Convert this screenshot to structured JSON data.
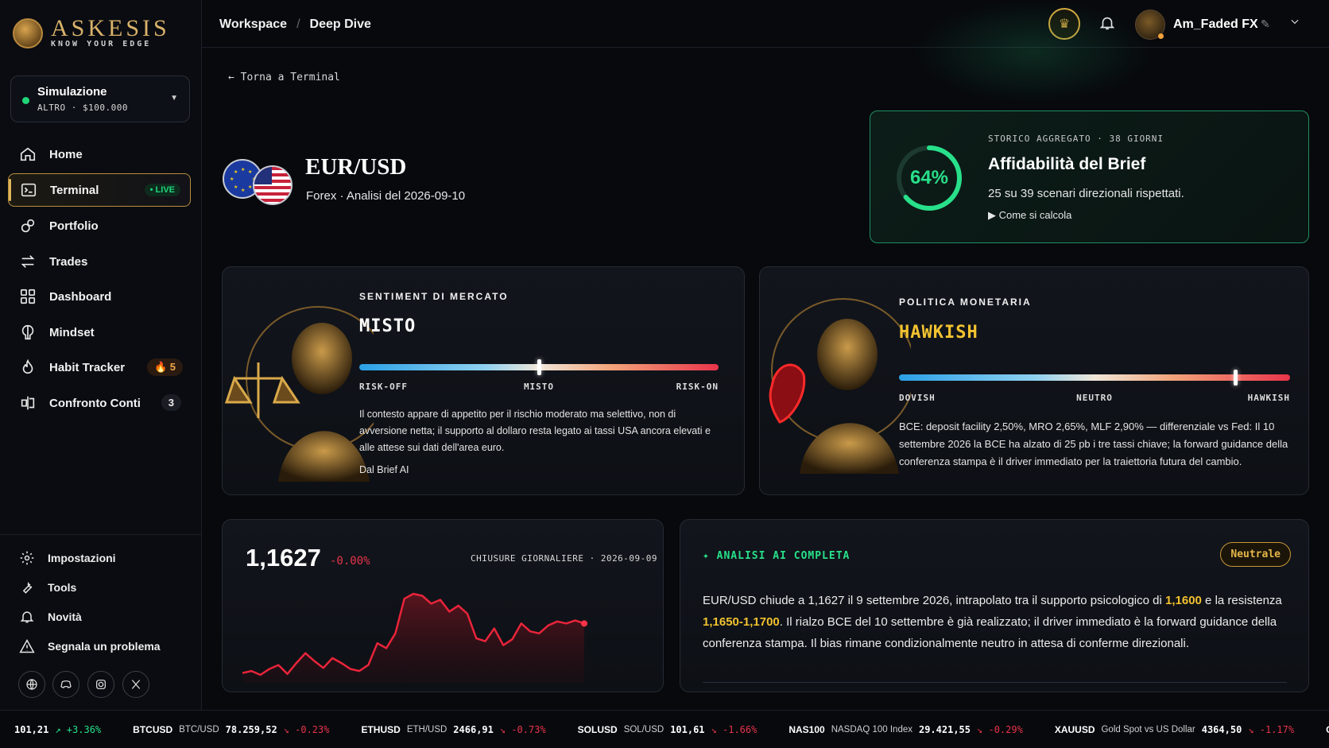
{
  "brand": {
    "name": "ASKESIS",
    "tagline": "KNOW YOUR EDGE"
  },
  "account": {
    "name": "Simulazione",
    "sub": "ALTRO · $100.000"
  },
  "sidebar": {
    "items": [
      {
        "label": "Home",
        "icon": "home-icon"
      },
      {
        "label": "Terminal",
        "icon": "terminal-icon",
        "badge": "• LIVE"
      },
      {
        "label": "Portfolio",
        "icon": "portfolio-icon"
      },
      {
        "label": "Trades",
        "icon": "trades-icon"
      },
      {
        "label": "Dashboard",
        "icon": "dashboard-icon"
      },
      {
        "label": "Mindset",
        "icon": "mindset-icon"
      },
      {
        "label": "Habit Tracker",
        "icon": "flame-icon",
        "badge": "5"
      },
      {
        "label": "Confronto Conti",
        "icon": "compare-icon",
        "badge": "3"
      }
    ],
    "bottom": [
      {
        "label": "Impostazioni",
        "icon": "gear-icon"
      },
      {
        "label": "Tools",
        "icon": "wrench-icon"
      },
      {
        "label": "Novità",
        "icon": "bell-icon"
      },
      {
        "label": "Segnala un problema",
        "icon": "warning-icon"
      }
    ],
    "social": [
      "globe-icon",
      "discord-icon",
      "instagram-icon",
      "x-icon"
    ]
  },
  "header": {
    "breadcrumb": [
      "Workspace",
      "Deep Dive"
    ],
    "username": "Am_Faded FX"
  },
  "page": {
    "back_label": "← Torna a Terminal",
    "pair": "EUR/USD",
    "subtitle": "Forex · Analisi del 2026-09-10"
  },
  "reliability": {
    "percent_label": "64%",
    "percent": 0.64,
    "kicker": "STORICO AGGREGATO · 38 GIORNI",
    "title": "Affidabilità del Brief",
    "desc": "25 su 39 scenari direzionali rispettati.",
    "how": "▶ Come si calcola"
  },
  "sentiment": {
    "kicker": "SENTIMENT DI MERCATO",
    "value": "MISTO",
    "position": 0.5,
    "labels": [
      "RISK-OFF",
      "MISTO",
      "RISK-ON"
    ],
    "text": "Il contesto appare di appetito per il rischio moderato ma selettivo, non di avversione netta; il supporto al dollaro resta legato ai tassi USA ancora elevati e alle attese sui dati dell'area euro.",
    "source": "Dal Brief AI"
  },
  "policy": {
    "kicker": "POLITICA MONETARIA",
    "value": "HAWKISH",
    "position": 0.86,
    "labels": [
      "DOVISH",
      "NEUTRO",
      "HAWKISH"
    ],
    "text": "BCE: deposit facility 2,50%, MRO 2,65%, MLF 2,90% — differenziale vs Fed: Il 10 settembre 2026 la BCE ha alzato di 25 pb i tre tassi chiave; la forward guidance della conferenza stampa è il driver immediato per la traiettoria futura del cambio."
  },
  "price": {
    "value": "1,1627",
    "change": "-0.00%",
    "meta": "CHIUSURE GIORNALIERE · 2026-09-09"
  },
  "chart_data": {
    "type": "area",
    "title": "",
    "xlabel": "",
    "ylabel": "",
    "values": [
      10,
      12,
      8,
      14,
      18,
      9,
      20,
      30,
      22,
      15,
      25,
      20,
      14,
      12,
      18,
      40,
      35,
      50,
      85,
      90,
      88,
      80,
      84,
      72,
      78,
      70,
      45,
      42,
      55,
      38,
      44,
      60,
      52,
      50,
      58,
      62,
      60,
      63,
      60
    ]
  },
  "analysis": {
    "kicker": "✦ ANALISI AI COMPLETA",
    "badge": "Neutrale",
    "p1": "EUR/USD chiude a 1,1627 il 9 settembre 2026, intrapolato tra il supporto psicologico di ",
    "h1": "1,1600",
    "p2": " e la resistenza ",
    "h2": "1,1650-1,1700",
    "p3": ". Il rialzo BCE del 10 settembre è già realizzato; il driver immediato è la forward guidance della conferenza stampa. Il bias rimane condizionalmente neutro in attesa di conferme direzionali."
  },
  "ticker": [
    {
      "sym": "",
      "name": "",
      "price": "101,21",
      "chg": "↗ +3.36%",
      "dir": "up"
    },
    {
      "sym": "BTCUSD",
      "name": "BTC/USD",
      "price": "78.259,52",
      "chg": "↘ -0.23%",
      "dir": "dn"
    },
    {
      "sym": "ETHUSD",
      "name": "ETH/USD",
      "price": "2466,91",
      "chg": "↘ -0.73%",
      "dir": "dn"
    },
    {
      "sym": "SOLUSD",
      "name": "SOL/USD",
      "price": "101,61",
      "chg": "↘ -1.66%",
      "dir": "dn"
    },
    {
      "sym": "NAS100",
      "name": "NASDAQ 100 Index",
      "price": "29.421,55",
      "chg": "↘ -0.29%",
      "dir": "dn"
    },
    {
      "sym": "XAUUSD",
      "name": "Gold Spot vs US Dollar",
      "price": "4364,50",
      "chg": "↘ -1.17%",
      "dir": "dn"
    },
    {
      "sym": "GER",
      "name": "",
      "price": "",
      "chg": "",
      "dir": "dn"
    }
  ],
  "colors": {
    "accent_gold": "#e0b55a",
    "green": "#28e08a",
    "red": "#e8344a",
    "hawkish": "#f2c230"
  }
}
